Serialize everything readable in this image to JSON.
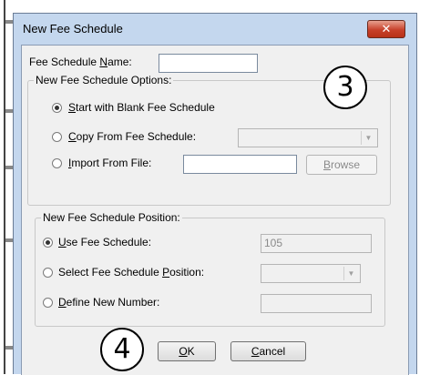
{
  "window": {
    "title": "New Fee Schedule",
    "close_glyph": "✕"
  },
  "name_field": {
    "label_pre": "Fee Schedule ",
    "label_u": "N",
    "label_post": "ame:",
    "value": ""
  },
  "options_group": {
    "legend": "New Fee Schedule Options:",
    "blank": {
      "u": "S",
      "rest": "tart with Blank Fee Schedule",
      "checked": true
    },
    "copy": {
      "u": "C",
      "rest": "opy From Fee Schedule:",
      "checked": false,
      "value": ""
    },
    "import": {
      "u": "I",
      "rest": "mport From File:",
      "checked": false,
      "value": ""
    },
    "browse": {
      "u": "B",
      "rest": "rowse"
    }
  },
  "position_group": {
    "legend": "New Fee Schedule Position:",
    "use": {
      "u": "U",
      "rest": "se Fee Schedule:",
      "checked": true,
      "value": "105"
    },
    "select": {
      "pre": "Select Fee Schedule ",
      "u": "P",
      "rest": "osition:",
      "checked": false,
      "value": ""
    },
    "define": {
      "u": "D",
      "rest": "efine New Number:",
      "checked": false,
      "value": ""
    }
  },
  "buttons": {
    "ok": {
      "u": "O",
      "rest": "K"
    },
    "cancel": {
      "u": "C",
      "rest": "ancel"
    }
  },
  "callouts": {
    "top": "3",
    "bottom": "4"
  },
  "icons": {
    "close": "close-icon",
    "dropdown": "chevron-down-icon"
  },
  "colors": {
    "frame": "#c4d7ee",
    "close_button": "#c7402a",
    "client": "#f0f0f0"
  }
}
